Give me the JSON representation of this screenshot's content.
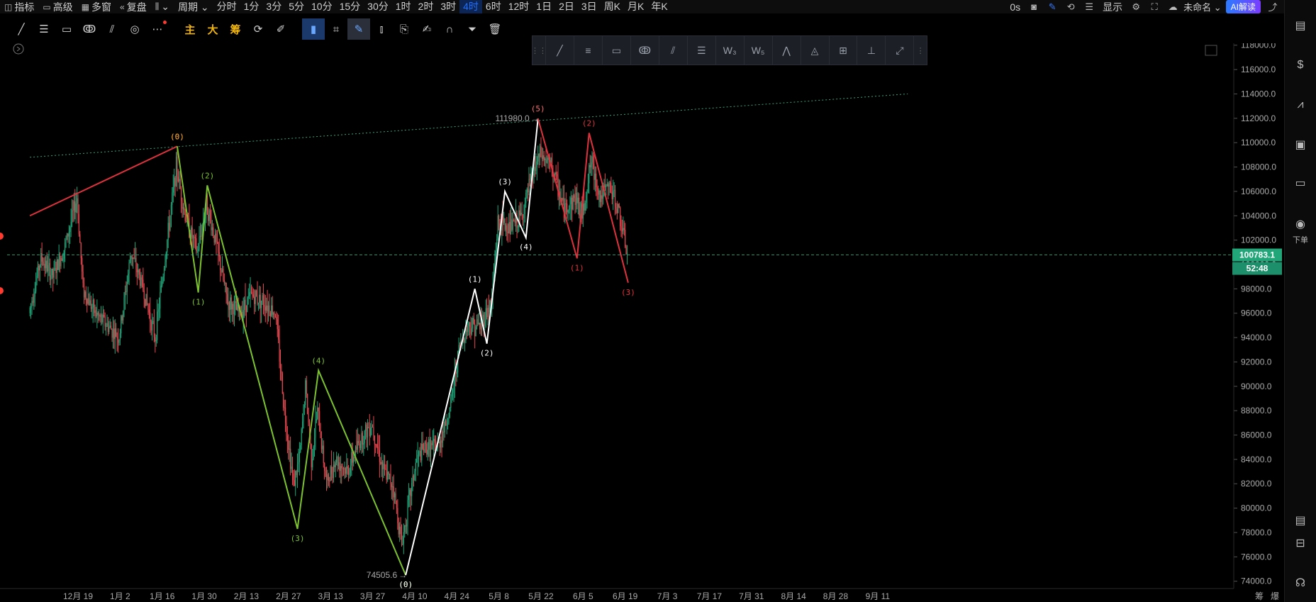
{
  "topbar": {
    "items": [
      {
        "icon": "indicator-icon",
        "glyph": "◫",
        "label": "指标"
      },
      {
        "icon": "advanced-icon",
        "glyph": "▭",
        "label": "高级"
      },
      {
        "icon": "multi-window-icon",
        "glyph": "▦",
        "label": "多窗"
      },
      {
        "icon": "replay-icon",
        "glyph": "«",
        "label": "复盘"
      },
      {
        "icon": "chart-type-icon",
        "glyph": "⫼",
        "label": "⌄"
      },
      {
        "icon": "",
        "glyph": "",
        "label": "周期 ⌄"
      }
    ],
    "timeframes": [
      "分时",
      "1分",
      "3分",
      "5分",
      "10分",
      "15分",
      "30分",
      "1时",
      "2时",
      "3时",
      "4时",
      "6时",
      "12时",
      "1日",
      "2日",
      "3日",
      "周K",
      "月K",
      "年K"
    ],
    "active_timeframe": "4时",
    "right": {
      "countdown": "0s",
      "display_label": "显示",
      "unnamed_label": "未命名 ⌄",
      "ai_label": "AI解读"
    }
  },
  "drawbar": {
    "icons": [
      "line-tool-icon",
      "parallel-channel-icon",
      "rectangle-icon",
      "pattern-icon",
      "fib-icon",
      "circle-icon",
      "more-icon"
    ],
    "yellow_labels": [
      "主",
      "大",
      "筹"
    ]
  },
  "floatbar": {
    "icons": [
      "trend-line-icon",
      "horizontal-lines-icon",
      "rectangle-icon",
      "pitchfork-icon",
      "parallel-icon",
      "fib-levels-icon",
      "wave-w3-icon",
      "wave-w5-icon",
      "pattern-abc-icon",
      "shape-icon",
      "measure-icon",
      "price-range-icon",
      "ray-icon"
    ]
  },
  "rightbar": {
    "order_label": "下单"
  },
  "chart_data": {
    "type": "candlestick",
    "title": "",
    "y_ticks": [
      74000,
      76000,
      78000,
      80000,
      82000,
      84000,
      86000,
      88000,
      90000,
      92000,
      94000,
      96000,
      98000,
      100000,
      102000,
      104000,
      106000,
      108000,
      110000,
      112000,
      114000,
      116000,
      118000
    ],
    "y_tick_labels": [
      "74000.0",
      "76000.0",
      "78000.0",
      "80000.0",
      "82000.0",
      "84000.0",
      "86000.0",
      "88000.0",
      "90000.0",
      "92000.0",
      "94000.0",
      "96000.0",
      "98000.0",
      "100000.0",
      "102000.0",
      "104000.0",
      "106000.0",
      "108000.0",
      "110000.0",
      "112000.0",
      "114000.0",
      "116000.0",
      "118000.0"
    ],
    "ylim": [
      73400,
      118800
    ],
    "x_ticks": [
      "12月 19",
      "1月 2",
      "1月 16",
      "1月 30",
      "2月 13",
      "2月 27",
      "3月 13",
      "3月 27",
      "4月 10",
      "4月 24",
      "5月 8",
      "5月 22",
      "6月 5",
      "6月 19",
      "7月 3",
      "7月 17",
      "7月 31",
      "8月 14",
      "8月 28",
      "9月 11"
    ],
    "x_tick_index": [
      0,
      7,
      14,
      21,
      28,
      35,
      42,
      49,
      56,
      63,
      70,
      77,
      84,
      91,
      98,
      105,
      112,
      119,
      126,
      133
    ],
    "x_suffix_labels": [
      "筹",
      "爆"
    ],
    "current_price": "100783.1",
    "current_price_value": 100783.1,
    "countdown": "52:48",
    "annotations": [
      {
        "text": "111980.0",
        "day": 76.5,
        "price": 111980
      },
      {
        "text": "74505.6",
        "day": 54.5,
        "price": 74505.6
      }
    ],
    "trendline": {
      "from": {
        "day": -8,
        "price": 108800
      },
      "to": {
        "day": 138,
        "price": 114000
      }
    },
    "waves": [
      {
        "name": "red",
        "color": "#e0323c",
        "points": [
          {
            "day": -8,
            "price": 104000,
            "label": ""
          },
          {
            "day": 16.5,
            "price": 109700,
            "label": "(0)"
          }
        ]
      },
      {
        "name": "green",
        "color": "#7cc42e",
        "points": [
          {
            "day": 16.5,
            "price": 109700,
            "label": "(0)"
          },
          {
            "day": 20,
            "price": 97700,
            "label": "(1)"
          },
          {
            "day": 21.5,
            "price": 106500,
            "label": "(2)"
          },
          {
            "day": 36.5,
            "price": 78300,
            "label": "(3)"
          },
          {
            "day": 40,
            "price": 91300,
            "label": "(4)"
          },
          {
            "day": 54.5,
            "price": 74500,
            "label": "(0)"
          }
        ]
      },
      {
        "name": "white",
        "color": "#ffffff",
        "points": [
          {
            "day": 54.5,
            "price": 74500,
            "label": "(0)"
          },
          {
            "day": 66,
            "price": 98000,
            "label": "(1)"
          },
          {
            "day": 68,
            "price": 93500,
            "label": "(2)"
          },
          {
            "day": 71,
            "price": 106000,
            "label": "(3)"
          },
          {
            "day": 74.5,
            "price": 102200,
            "label": "(4)"
          },
          {
            "day": 76.5,
            "price": 111980,
            "label": "(5)"
          }
        ]
      },
      {
        "name": "red-down",
        "color": "#e0323c",
        "points": [
          {
            "day": 76.5,
            "price": 111980,
            "label": ""
          },
          {
            "day": 83,
            "price": 100500,
            "label": "(1)"
          },
          {
            "day": 85,
            "price": 110800,
            "label": "(2)"
          },
          {
            "day": 91.5,
            "price": 98500,
            "label": "(3)"
          }
        ]
      }
    ],
    "series_anchor": [
      {
        "day": -8,
        "price": 96000
      },
      {
        "day": -6,
        "price": 100500
      },
      {
        "day": -4,
        "price": 99000
      },
      {
        "day": -2,
        "price": 101500
      },
      {
        "day": 0,
        "price": 105500
      },
      {
        "day": 1,
        "price": 98000
      },
      {
        "day": 3,
        "price": 96000
      },
      {
        "day": 5,
        "price": 95000
      },
      {
        "day": 7,
        "price": 94000
      },
      {
        "day": 9,
        "price": 101000
      },
      {
        "day": 11,
        "price": 98000
      },
      {
        "day": 13,
        "price": 94000
      },
      {
        "day": 15,
        "price": 102000
      },
      {
        "day": 16.5,
        "price": 108000
      },
      {
        "day": 18,
        "price": 104000
      },
      {
        "day": 20,
        "price": 101000
      },
      {
        "day": 21.5,
        "price": 105000
      },
      {
        "day": 23,
        "price": 102000
      },
      {
        "day": 25,
        "price": 97000
      },
      {
        "day": 27,
        "price": 96000
      },
      {
        "day": 29,
        "price": 97500
      },
      {
        "day": 31,
        "price": 97000
      },
      {
        "day": 33,
        "price": 96000
      },
      {
        "day": 34.5,
        "price": 88000
      },
      {
        "day": 36,
        "price": 82000
      },
      {
        "day": 37,
        "price": 84000
      },
      {
        "day": 38,
        "price": 90000
      },
      {
        "day": 39,
        "price": 84000
      },
      {
        "day": 40,
        "price": 88000
      },
      {
        "day": 41.5,
        "price": 82000
      },
      {
        "day": 43,
        "price": 84000
      },
      {
        "day": 45,
        "price": 83000
      },
      {
        "day": 47,
        "price": 85500
      },
      {
        "day": 49,
        "price": 87000
      },
      {
        "day": 51,
        "price": 83000
      },
      {
        "day": 52.5,
        "price": 82000
      },
      {
        "day": 54,
        "price": 77000
      },
      {
        "day": 55,
        "price": 80000
      },
      {
        "day": 56.5,
        "price": 84000
      },
      {
        "day": 58,
        "price": 85000
      },
      {
        "day": 60,
        "price": 85000
      },
      {
        "day": 62,
        "price": 88000
      },
      {
        "day": 63.5,
        "price": 93000
      },
      {
        "day": 65,
        "price": 95000
      },
      {
        "day": 67,
        "price": 95000
      },
      {
        "day": 69,
        "price": 97000
      },
      {
        "day": 70,
        "price": 103500
      },
      {
        "day": 72,
        "price": 103000
      },
      {
        "day": 74,
        "price": 104000
      },
      {
        "day": 75.5,
        "price": 107000
      },
      {
        "day": 77,
        "price": 109000
      },
      {
        "day": 79,
        "price": 108000
      },
      {
        "day": 81,
        "price": 104500
      },
      {
        "day": 83,
        "price": 105500
      },
      {
        "day": 84,
        "price": 104000
      },
      {
        "day": 85.5,
        "price": 108500
      },
      {
        "day": 87,
        "price": 105500
      },
      {
        "day": 88.5,
        "price": 106500
      },
      {
        "day": 90,
        "price": 104500
      },
      {
        "day": 91.5,
        "price": 100800
      }
    ]
  }
}
